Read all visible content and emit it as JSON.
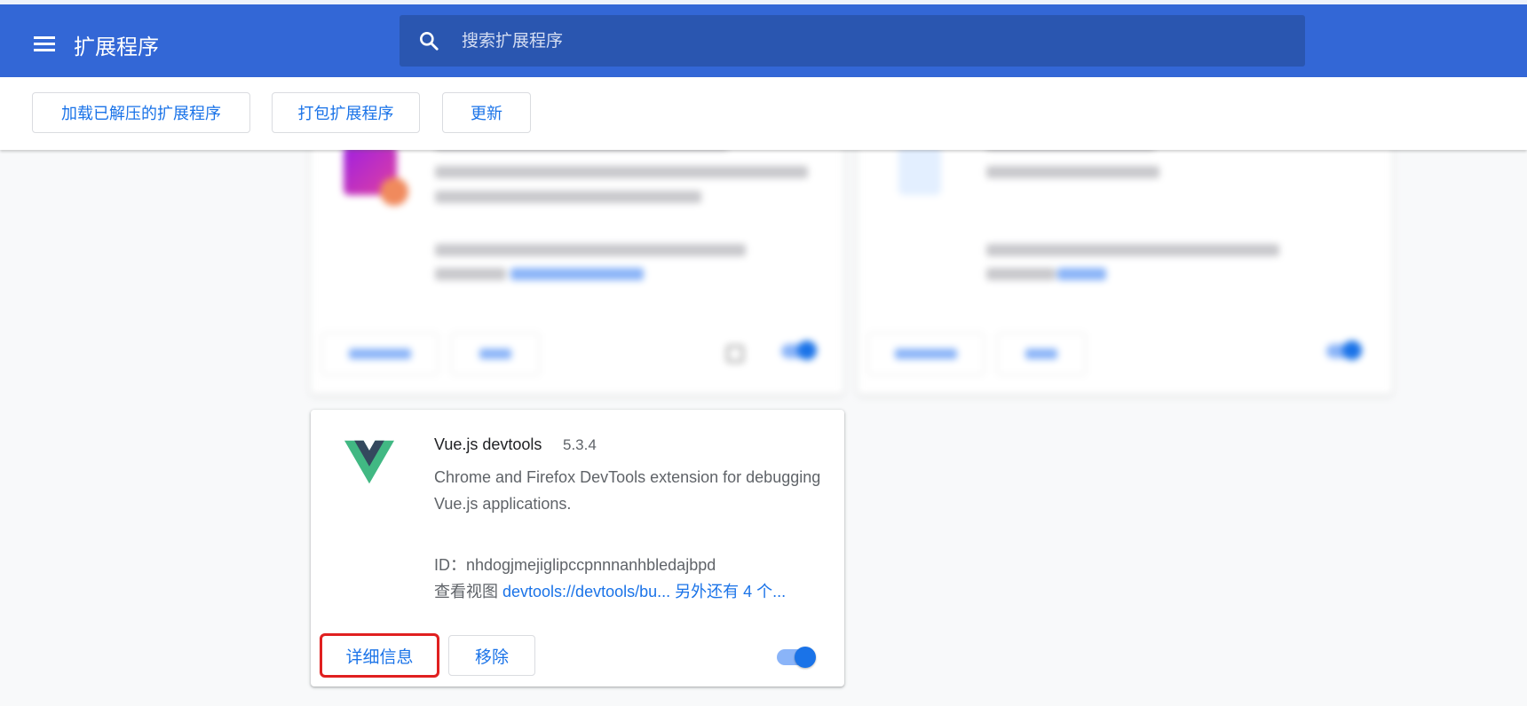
{
  "header": {
    "title": "扩展程序",
    "search_placeholder": "搜索扩展程序"
  },
  "toolbar": {
    "load_unpacked": "加载已解压的扩展程序",
    "pack_extension": "打包扩展程序",
    "update": "更新"
  },
  "extension": {
    "name": "Vue.js devtools",
    "version": "5.3.4",
    "description": "Chrome and Firefox DevTools extension for debugging Vue.js applications.",
    "id_label": "ID：",
    "id": "nhdogjmejiglipccpnnnanhbledajbpd",
    "views_label": "查看视图",
    "view_link": "devtools://devtools/bu...",
    "more_views": "另外还有 4 个...",
    "details_button": "详细信息",
    "remove_button": "移除",
    "enabled": true
  },
  "colors": {
    "header_bg": "#3367d6",
    "search_bg": "#2a56b0",
    "accent": "#1a73e8",
    "highlight": "#e02020"
  }
}
